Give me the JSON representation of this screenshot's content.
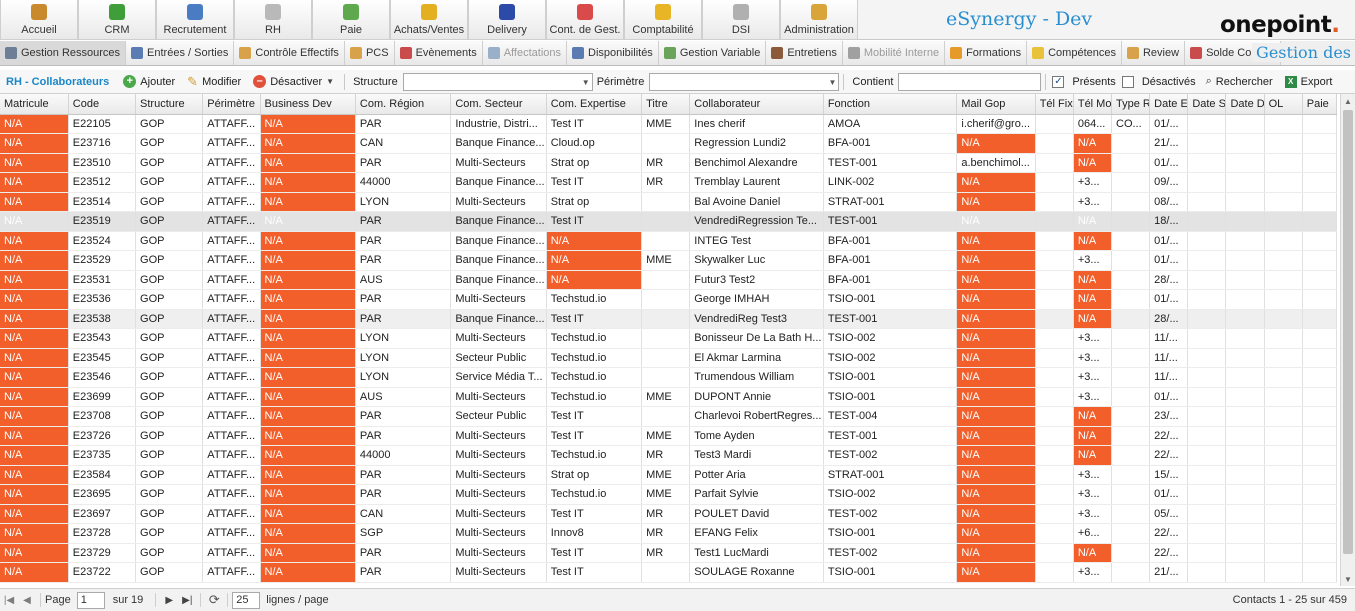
{
  "app": {
    "title": "eSynergy - Dev",
    "logo_text": "onepoint",
    "logo_dot": "."
  },
  "modules": [
    {
      "label": "Accueil",
      "icon": "home-icon",
      "color": "#c98a2e"
    },
    {
      "label": "CRM",
      "icon": "crm-chart-icon",
      "color": "#3f9d3a"
    },
    {
      "label": "Recrutement",
      "icon": "recruitment-icon",
      "color": "#4a7cc4"
    },
    {
      "label": "RH",
      "icon": "hr-folder-icon",
      "color": "#b9b9b9"
    },
    {
      "label": "Paie",
      "icon": "pay-icon",
      "color": "#5ea84d"
    },
    {
      "label": "Achats/Ventes",
      "icon": "euro-icon",
      "color": "#e3b021"
    },
    {
      "label": "Delivery",
      "icon": "delivery-icon",
      "color": "#2c4aa8"
    },
    {
      "label": "Cont. de Gest.",
      "icon": "control-chart-icon",
      "color": "#d94b4b"
    },
    {
      "label": "Comptabilité",
      "icon": "coins-icon",
      "color": "#e8b526"
    },
    {
      "label": "DSI",
      "icon": "dsi-icon",
      "color": "#b0b0b0"
    },
    {
      "label": "Administration",
      "icon": "admin-icon",
      "color": "#d9a53a"
    }
  ],
  "tabs": [
    {
      "label": "Gestion Ressources",
      "icon": "resources-icon",
      "color": "#6c7f96",
      "active": true,
      "disabled": false
    },
    {
      "label": "Entrées / Sorties",
      "icon": "in-out-icon",
      "color": "#5a7cb3",
      "active": false,
      "disabled": false
    },
    {
      "label": "Contrôle Effectifs",
      "icon": "headcount-icon",
      "color": "#d7a24a",
      "active": false,
      "disabled": false
    },
    {
      "label": "PCS",
      "icon": "pcs-icon",
      "color": "#d7a24a",
      "active": false,
      "disabled": false
    },
    {
      "label": "Evènements",
      "icon": "calendar-icon",
      "color": "#c94b4b",
      "active": false,
      "disabled": false
    },
    {
      "label": "Affectations",
      "icon": "assignment-icon",
      "color": "#9ab0c8",
      "active": false,
      "disabled": true
    },
    {
      "label": "Disponibilités",
      "icon": "availability-icon",
      "color": "#5a7cb3",
      "active": false,
      "disabled": false
    },
    {
      "label": "Gestion Variable",
      "icon": "variable-icon",
      "color": "#6aa35a",
      "active": false,
      "disabled": false
    },
    {
      "label": "Entretiens",
      "icon": "interview-icon",
      "color": "#8a5a3a",
      "active": false,
      "disabled": false
    },
    {
      "label": "Mobilité Interne",
      "icon": "mobility-icon",
      "color": "#a0a0a0",
      "active": false,
      "disabled": true
    },
    {
      "label": "Formations",
      "icon": "training-icon",
      "color": "#e59a2a",
      "active": false,
      "disabled": false
    },
    {
      "label": "Compétences",
      "icon": "skills-icon",
      "color": "#e8c33a",
      "active": false,
      "disabled": false
    },
    {
      "label": "Review",
      "icon": "review-icon",
      "color": "#d7a24a",
      "active": false,
      "disabled": false
    },
    {
      "label": "Solde Congés",
      "icon": "leave-calendar-icon",
      "color": "#c94b4b",
      "active": false,
      "disabled": false
    }
  ],
  "tabs_title": "Gestion des",
  "toolbar": {
    "title": "RH - Collaborateurs",
    "add": "Ajouter",
    "edit": "Modifier",
    "deactivate": "Désactiver",
    "structure_label": "Structure",
    "structure_value": "",
    "perimetre_label": "Périmètre",
    "perimetre_value": "",
    "contient_label": "Contient",
    "contient_value": "",
    "presents_label": "Présents",
    "presents_checked": true,
    "desactives_label": "Désactivés",
    "desactives_checked": false,
    "search": "Rechercher",
    "export": "Export"
  },
  "columns": [
    "Matricule",
    "Code",
    "Structure",
    "Périmètre",
    "Business Dev",
    "Com. Région",
    "Com. Secteur",
    "Com. Expertise",
    "Titre",
    "Collaborateur",
    "Fonction",
    "Mail Gop",
    "Tél Fixe",
    "Tél Mo",
    "Type R",
    "Date E",
    "Date S",
    "Date D",
    "OL",
    "Paie"
  ],
  "rows": [
    [
      "N/A",
      "E22105",
      "GOP",
      "ATTAFF...",
      "N/A",
      "PAR",
      "Industrie, Distri...",
      "Test IT",
      "MME",
      "Ines cherif",
      "AMOA",
      "i.cherif@gro...",
      "",
      "064...",
      "CO...",
      "01/...",
      "",
      "",
      "",
      ""
    ],
    [
      "N/A",
      "E23716",
      "GOP",
      "ATTAFF...",
      "N/A",
      "CAN",
      "Banque Finance...",
      "Cloud.op",
      "",
      "Regression Lundi2",
      "BFA-001",
      "N/A",
      "",
      "N/A",
      "",
      "21/...",
      "",
      "",
      "",
      ""
    ],
    [
      "N/A",
      "E23510",
      "GOP",
      "ATTAFF...",
      "N/A",
      "PAR",
      "Multi-Secteurs",
      "Strat op",
      "MR",
      "Benchimol Alexandre",
      "TEST-001",
      "a.benchimol...",
      "",
      "N/A",
      "",
      "01/...",
      "",
      "",
      "",
      ""
    ],
    [
      "N/A",
      "E23512",
      "GOP",
      "ATTAFF...",
      "N/A",
      "44000",
      "Banque Finance...",
      "Test IT",
      "MR",
      "Tremblay Laurent",
      "LINK-002",
      "N/A",
      "",
      "+3...",
      "",
      "09/...",
      "",
      "",
      "",
      ""
    ],
    [
      "N/A",
      "E23514",
      "GOP",
      "ATTAFF...",
      "N/A",
      "LYON",
      "Multi-Secteurs",
      "Strat op",
      "",
      "Bal Avoine Daniel",
      "STRAT-001",
      "N/A",
      "",
      "+3...",
      "",
      "08/...",
      "",
      "",
      "",
      ""
    ],
    [
      "N/A",
      "E23519",
      "GOP",
      "ATTAFF...",
      "N/A",
      "PAR",
      "Banque Finance...",
      "Test IT",
      "",
      "VendrediRegression Te...",
      "TEST-001",
      "N/A",
      "",
      "N/A",
      "",
      "18/...",
      "",
      "",
      "",
      ""
    ],
    [
      "N/A",
      "E23524",
      "GOP",
      "ATTAFF...",
      "N/A",
      "PAR",
      "Banque Finance...",
      "N/A",
      "",
      "INTEG Test",
      "BFA-001",
      "N/A",
      "",
      "N/A",
      "",
      "01/...",
      "",
      "",
      "",
      ""
    ],
    [
      "N/A",
      "E23529",
      "GOP",
      "ATTAFF...",
      "N/A",
      "PAR",
      "Banque Finance...",
      "N/A",
      "MME",
      "Skywalker Luc",
      "BFA-001",
      "N/A",
      "",
      "+3...",
      "",
      "01/...",
      "",
      "",
      "",
      ""
    ],
    [
      "N/A",
      "E23531",
      "GOP",
      "ATTAFF...",
      "N/A",
      "AUS",
      "Banque Finance...",
      "N/A",
      "",
      "Futur3 Test2",
      "BFA-001",
      "N/A",
      "",
      "N/A",
      "",
      "28/...",
      "",
      "",
      "",
      ""
    ],
    [
      "N/A",
      "E23536",
      "GOP",
      "ATTAFF...",
      "N/A",
      "PAR",
      "Multi-Secteurs",
      "Techstud.io",
      "",
      "George IMHAH",
      "TSIO-001",
      "N/A",
      "",
      "N/A",
      "",
      "01/...",
      "",
      "",
      "",
      ""
    ],
    [
      "N/A",
      "E23538",
      "GOP",
      "ATTAFF...",
      "N/A",
      "PAR",
      "Banque Finance...",
      "Test IT",
      "",
      "VendrediReg Test3",
      "TEST-001",
      "N/A",
      "",
      "N/A",
      "",
      "28/...",
      "",
      "",
      "",
      ""
    ],
    [
      "N/A",
      "E23543",
      "GOP",
      "ATTAFF...",
      "N/A",
      "LYON",
      "Multi-Secteurs",
      "Techstud.io",
      "",
      "Bonisseur De La Bath H...",
      "TSIO-002",
      "N/A",
      "",
      "+3...",
      "",
      "11/...",
      "",
      "",
      "",
      ""
    ],
    [
      "N/A",
      "E23545",
      "GOP",
      "ATTAFF...",
      "N/A",
      "LYON",
      "Secteur Public",
      "Techstud.io",
      "",
      "El Akmar Larmina",
      "TSIO-002",
      "N/A",
      "",
      "+3...",
      "",
      "11/...",
      "",
      "",
      "",
      ""
    ],
    [
      "N/A",
      "E23546",
      "GOP",
      "ATTAFF...",
      "N/A",
      "LYON",
      "Service Média T...",
      "Techstud.io",
      "",
      "Trumendous William",
      "TSIO-001",
      "N/A",
      "",
      "+3...",
      "",
      "11/...",
      "",
      "",
      "",
      ""
    ],
    [
      "N/A",
      "E23699",
      "GOP",
      "ATTAFF...",
      "N/A",
      "AUS",
      "Multi-Secteurs",
      "Techstud.io",
      "MME",
      "DUPONT Annie",
      "TSIO-001",
      "N/A",
      "",
      "+3...",
      "",
      "01/...",
      "",
      "",
      "",
      ""
    ],
    [
      "N/A",
      "E23708",
      "GOP",
      "ATTAFF...",
      "N/A",
      "PAR",
      "Secteur Public",
      "Test IT",
      "",
      "Charlevoi RobertRegres...",
      "TEST-004",
      "N/A",
      "",
      "N/A",
      "",
      "23/...",
      "",
      "",
      "",
      ""
    ],
    [
      "N/A",
      "E23726",
      "GOP",
      "ATTAFF...",
      "N/A",
      "PAR",
      "Multi-Secteurs",
      "Test IT",
      "MME",
      "Tome Ayden",
      "TEST-001",
      "N/A",
      "",
      "N/A",
      "",
      "22/...",
      "",
      "",
      "",
      ""
    ],
    [
      "N/A",
      "E23735",
      "GOP",
      "ATTAFF...",
      "N/A",
      "44000",
      "Multi-Secteurs",
      "Techstud.io",
      "MR",
      "Test3 Mardi",
      "TEST-002",
      "N/A",
      "",
      "N/A",
      "",
      "22/...",
      "",
      "",
      "",
      ""
    ],
    [
      "N/A",
      "E23584",
      "GOP",
      "ATTAFF...",
      "N/A",
      "PAR",
      "Multi-Secteurs",
      "Strat op",
      "MME",
      "Potter Aria",
      "STRAT-001",
      "N/A",
      "",
      "+3...",
      "",
      "15/...",
      "",
      "",
      "",
      ""
    ],
    [
      "N/A",
      "E23695",
      "GOP",
      "ATTAFF...",
      "N/A",
      "PAR",
      "Multi-Secteurs",
      "Techstud.io",
      "MME",
      "Parfait Sylvie",
      "TSIO-002",
      "N/A",
      "",
      "+3...",
      "",
      "01/...",
      "",
      "",
      "",
      ""
    ],
    [
      "N/A",
      "E23697",
      "GOP",
      "ATTAFF...",
      "N/A",
      "CAN",
      "Multi-Secteurs",
      "Test IT",
      "MR",
      "POULET David",
      "TEST-002",
      "N/A",
      "",
      "+3...",
      "",
      "05/...",
      "",
      "",
      "",
      ""
    ],
    [
      "N/A",
      "E23728",
      "GOP",
      "ATTAFF...",
      "N/A",
      "SGP",
      "Multi-Secteurs",
      "Innov8",
      "MR",
      "EFANG Felix",
      "TSIO-001",
      "N/A",
      "",
      "+6...",
      "",
      "22/...",
      "",
      "",
      "",
      ""
    ],
    [
      "N/A",
      "E23729",
      "GOP",
      "ATTAFF...",
      "N/A",
      "PAR",
      "Multi-Secteurs",
      "Test IT",
      "MR",
      "Test1 LucMardi",
      "TEST-002",
      "N/A",
      "",
      "N/A",
      "",
      "22/...",
      "",
      "",
      "",
      ""
    ],
    [
      "N/A",
      "E23722",
      "GOP",
      "ATTAFF...",
      "N/A",
      "PAR",
      "Multi-Secteurs",
      "Test IT",
      "",
      "SOULAGE Roxanne",
      "TSIO-001",
      "N/A",
      "",
      "+3...",
      "",
      "21/...",
      "",
      "",
      "",
      ""
    ]
  ],
  "selected_row_index": 5,
  "highlighted_row_index": 10,
  "pager": {
    "page_label": "Page",
    "page_value": "1",
    "of_label": "sur 19",
    "page_size_value": "25",
    "page_size_label": "lignes / page",
    "status": "Contacts 1 - 25 sur 459"
  },
  "colors": {
    "na_cell": "#f35f2a",
    "brand_blue": "#2a8fcf",
    "title_blue": "#1a87c9"
  }
}
